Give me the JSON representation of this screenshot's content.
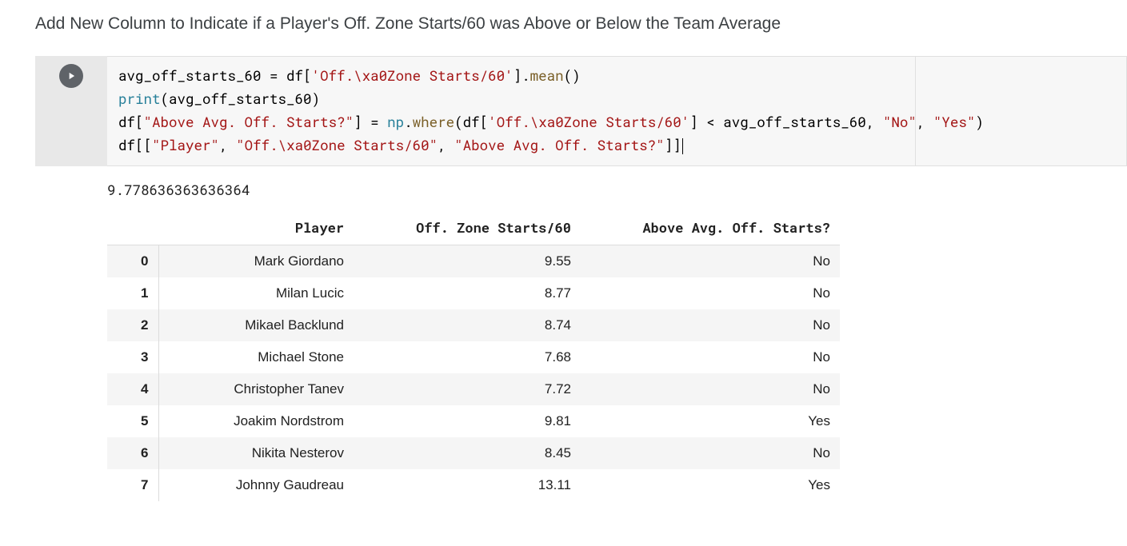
{
  "heading": "Add New Column to Indicate if a Player's Off. Zone Starts/60 was Above or Below the Team Average",
  "code": {
    "line1": {
      "lhs": "avg_off_starts_60",
      "eq": " = ",
      "df": "df",
      "br1": "[",
      "str1": "'Off.\\xa0Zone Starts/60'",
      "br2": "]",
      "dot": ".",
      "mean": "mean",
      "parens": "()"
    },
    "line2": {
      "print": "print",
      "open": "(",
      "arg": "avg_off_starts_60",
      "close": ")"
    },
    "line3": {
      "df": "df",
      "br1": "[",
      "key": "\"Above Avg. Off. Starts?\"",
      "br2": "]",
      "eq": " = ",
      "np": "np",
      "dot": ".",
      "where": "where",
      "open": "(",
      "df2": "df",
      "br3": "[",
      "col": "'Off.\\xa0Zone Starts/60'",
      "br4": "]",
      "lt": " < ",
      "rhsvar": "avg_off_starts_60",
      "comma1": ", ",
      "no": "\"No\"",
      "comma2": ", ",
      "yes": "\"Yes\"",
      "close": ")"
    },
    "line4": {
      "df": "df",
      "outer1": "[",
      "inner1": "[",
      "s1": "\"Player\"",
      "c1": ", ",
      "s2": "\"Off.\\xa0Zone Starts/60\"",
      "c2": ", ",
      "s3": "\"Above Avg. Off. Starts?\"",
      "inner2": "]",
      "outer2": "]"
    }
  },
  "output": {
    "printed": "9.778636363636364",
    "columns": [
      "Player",
      "Off. Zone Starts/60",
      "Above Avg. Off. Starts?"
    ],
    "rows": [
      {
        "idx": "0",
        "player": "Mark Giordano",
        "starts": "9.55",
        "above": "No"
      },
      {
        "idx": "1",
        "player": "Milan Lucic",
        "starts": "8.77",
        "above": "No"
      },
      {
        "idx": "2",
        "player": "Mikael Backlund",
        "starts": "8.74",
        "above": "No"
      },
      {
        "idx": "3",
        "player": "Michael Stone",
        "starts": "7.68",
        "above": "No"
      },
      {
        "idx": "4",
        "player": "Christopher Tanev",
        "starts": "7.72",
        "above": "No"
      },
      {
        "idx": "5",
        "player": "Joakim Nordstrom",
        "starts": "9.81",
        "above": "Yes"
      },
      {
        "idx": "6",
        "player": "Nikita Nesterov",
        "starts": "8.45",
        "above": "No"
      },
      {
        "idx": "7",
        "player": "Johnny Gaudreau",
        "starts": "13.11",
        "above": "Yes"
      }
    ]
  }
}
